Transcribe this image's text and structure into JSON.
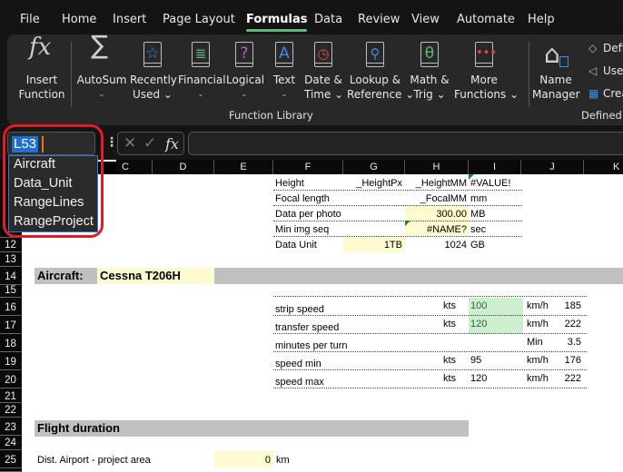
{
  "menu": {
    "tabs": [
      "File",
      "Home",
      "Insert",
      "Page Layout",
      "Formulas",
      "Data",
      "Review",
      "View",
      "Automate",
      "Help"
    ],
    "active": "Formulas"
  },
  "ribbon": {
    "insert_function": {
      "line1": "Insert",
      "line2": "Function",
      "icon": "fx-icon"
    },
    "buttons": [
      {
        "line1": "AutoSum",
        "line2": "⌄",
        "icon": "sigma-icon"
      },
      {
        "line1": "Recently",
        "line2": "Used ⌄",
        "icon": "star-book-icon"
      },
      {
        "line1": "Financial",
        "line2": "⌄",
        "icon": "coins-book-icon"
      },
      {
        "line1": "Logical",
        "line2": "⌄",
        "icon": "question-book-icon"
      },
      {
        "line1": "Text",
        "line2": "⌄",
        "icon": "text-book-icon"
      },
      {
        "line1": "Date &",
        "line2": "Time ⌄",
        "icon": "clock-book-icon"
      },
      {
        "line1": "Lookup &",
        "line2": "Reference ⌄",
        "icon": "magnifier-book-icon"
      },
      {
        "line1": "Math &",
        "line2": "Trig ⌄",
        "icon": "theta-book-icon"
      },
      {
        "line1": "More",
        "line2": "Functions ⌄",
        "icon": "dots-book-icon"
      }
    ],
    "group_function_library": "Function Library",
    "name_manager": {
      "line1": "Name",
      "line2": "Manager",
      "icon": "name-tag-icon"
    },
    "defined_small": [
      "Defin",
      "Use i",
      "Creat"
    ],
    "group_defined": "Defined"
  },
  "formula_bar": {
    "name_box": "L53",
    "formula": ""
  },
  "name_dropdown": {
    "items": [
      "Aircraft",
      "Data_Unit",
      "RangeLines",
      "RangeProject"
    ]
  },
  "columns": [
    "C",
    "D",
    "E",
    "F",
    "G",
    "H",
    "I",
    "J",
    "K"
  ],
  "rows": [
    "12",
    "13",
    "14",
    "15",
    "16",
    "17",
    "18",
    "19",
    "20",
    "21",
    "22",
    "23",
    "24",
    "25"
  ],
  "sheet": {
    "params": [
      {
        "label": "Height",
        "g": "_HeightPx",
        "h": "_HeightMM",
        "i": "#VALUE!"
      },
      {
        "label": "Focal length",
        "g": "",
        "h": "_FocalMM",
        "i": "mm"
      },
      {
        "label": "Data per photo",
        "g": "",
        "h": "300.00",
        "i": "MB"
      },
      {
        "label": "Min img seq",
        "g": "",
        "h": "#NAME?",
        "i": "sec"
      },
      {
        "label": "Data Unit",
        "g": "1TB",
        "h": "1024",
        "i": "GB"
      }
    ],
    "aircraft_label": "Aircraft:",
    "aircraft_value": "Cessna T206H",
    "speeds": [
      {
        "label": "strip speed",
        "unit1": "kts",
        "val1": "100",
        "unit2": "km/h",
        "val2": "185"
      },
      {
        "label": "transfer speed",
        "unit1": "kts",
        "val1": "120",
        "unit2": "km/h",
        "val2": "222"
      },
      {
        "label": "minutes per turn",
        "unit1": "",
        "val1": "",
        "unit2": "Min",
        "val2": "3.5"
      },
      {
        "label": "speed min",
        "unit1": "kts",
        "val1": "95",
        "unit2": "km/h",
        "val2": "176"
      },
      {
        "label": "speed max",
        "unit1": "kts",
        "val1": "120",
        "unit2": "km/h",
        "val2": "222"
      }
    ],
    "flight_duration_title": "Flight duration",
    "dist_label": "Dist. Airport - project area",
    "dist_value": "0",
    "dist_unit": "km"
  }
}
